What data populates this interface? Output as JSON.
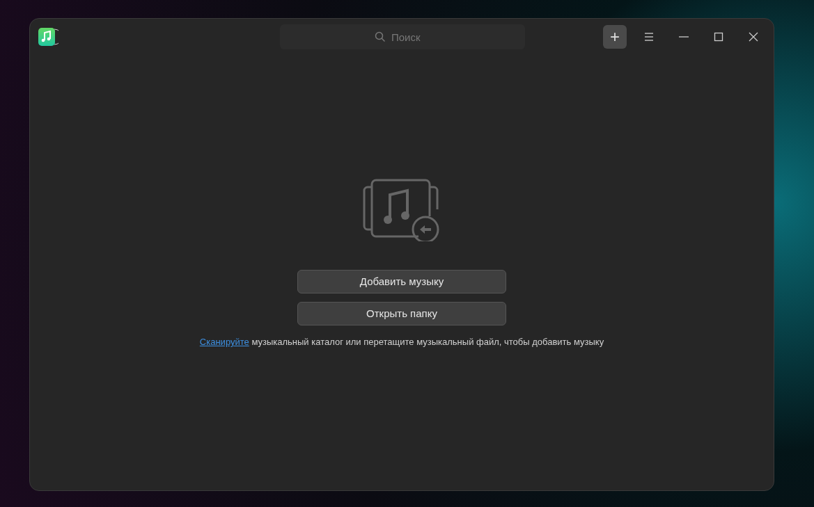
{
  "titlebar": {
    "search": {
      "placeholder": "Поиск"
    },
    "add_button": {
      "label": "+",
      "selected": true
    }
  },
  "empty_state": {
    "buttons": [
      "Добавить музыку",
      "Открыть папку"
    ],
    "hint": {
      "link": "Сканируйте",
      "text": " музыкальный каталог или перетащите музыкальный файл, чтобы добавить музыку"
    }
  }
}
